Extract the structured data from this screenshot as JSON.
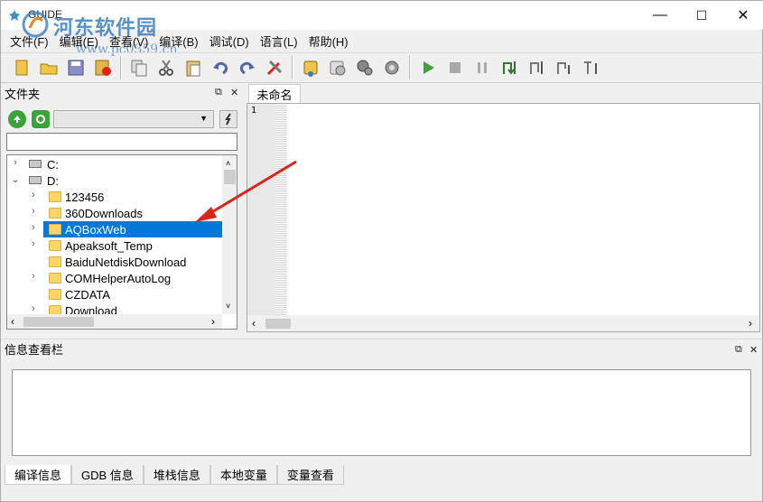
{
  "window": {
    "title": "GUIDE",
    "watermark": {
      "text": "河东软件园",
      "url": "www.pc0359.cn"
    },
    "controls": {
      "minimize": "—",
      "maximize": "☐",
      "close": "✕"
    }
  },
  "menu": [
    "文件(F)",
    "编辑(E)",
    "查看(V)",
    "编译(B)",
    "调试(D)",
    "语言(L)",
    "帮助(H)"
  ],
  "toolbar": {
    "groups": [
      [
        "new-file-icon",
        "open-folder-icon",
        "save-icon",
        "close-file-icon"
      ],
      [
        "copy-icon",
        "cut-icon",
        "paste-icon",
        "undo-icon",
        "redo-icon",
        "tools-icon"
      ],
      [
        "compile-icon",
        "build-icon",
        "settings-icon",
        "build-all-icon"
      ],
      [
        "run-icon",
        "stop-icon",
        "pause-icon",
        "step-into-icon",
        "step-over-icon",
        "step-out-icon",
        "run-to-cursor-icon"
      ]
    ]
  },
  "file_panel": {
    "title": "文件夹",
    "dock": "⧉",
    "close": "✕",
    "path_value": "",
    "tree": [
      {
        "label": "C:",
        "type": "drive",
        "level": 0,
        "chevron": "›"
      },
      {
        "label": "D:",
        "type": "drive",
        "level": 0,
        "chevron": "⌄"
      },
      {
        "label": "123456",
        "type": "folder",
        "level": 1,
        "chevron": "›"
      },
      {
        "label": "360Downloads",
        "type": "folder",
        "level": 1,
        "chevron": "›"
      },
      {
        "label": "AQBoxWeb",
        "type": "folder",
        "level": 1,
        "chevron": "›",
        "selected": true
      },
      {
        "label": "Apeaksoft_Temp",
        "type": "folder",
        "level": 1,
        "chevron": "›"
      },
      {
        "label": "BaiduNetdiskDownload",
        "type": "folder",
        "level": 1,
        "chevron": ""
      },
      {
        "label": "COMHelperAutoLog",
        "type": "folder",
        "level": 1,
        "chevron": "›"
      },
      {
        "label": "CZDATA",
        "type": "folder",
        "level": 1,
        "chevron": ""
      },
      {
        "label": "Download",
        "type": "folder",
        "level": 1,
        "chevron": "›"
      }
    ]
  },
  "editor": {
    "tab_label": "未命名",
    "line_number": "1"
  },
  "info_panel": {
    "title": "信息查看栏",
    "dock": "⧉",
    "close": "✕",
    "tabs": [
      "编译信息",
      "GDB 信息",
      "堆栈信息",
      "本地变量",
      "变量查看"
    ]
  },
  "colors": {
    "selection": "#0078d7",
    "accent_green": "#3aa33a",
    "annotation_arrow": "#d9261c"
  }
}
